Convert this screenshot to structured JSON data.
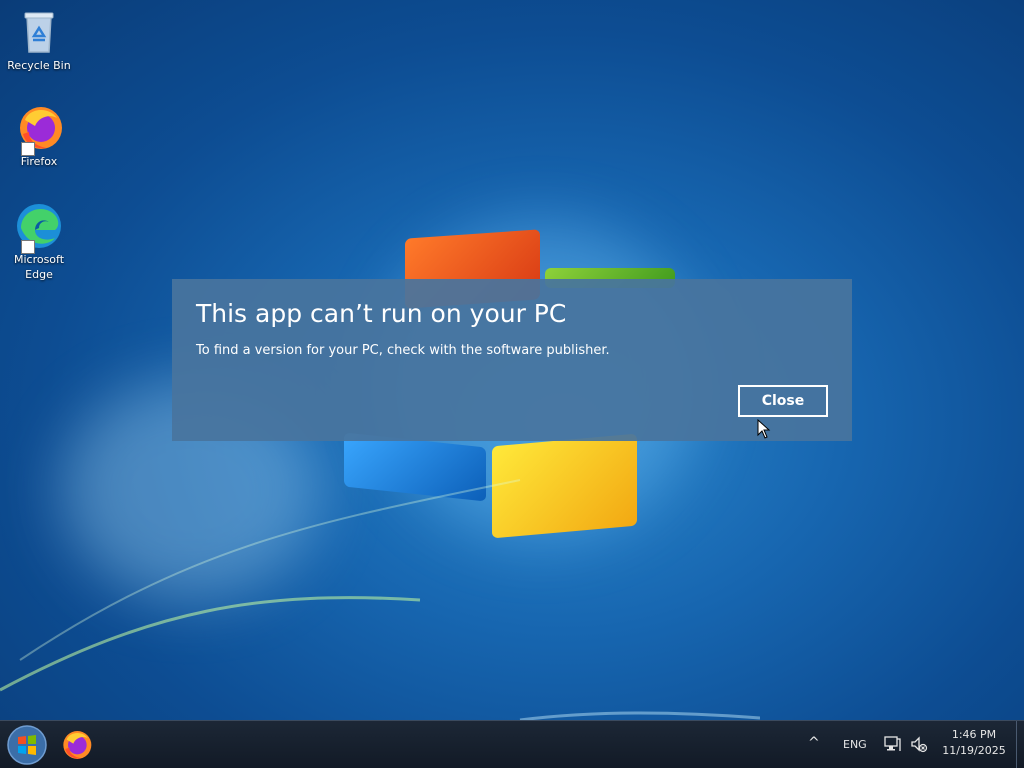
{
  "desktop": {
    "icons": [
      {
        "label": "Recycle Bin",
        "icon": "recycle-bin-icon"
      },
      {
        "label": "Firefox",
        "icon": "firefox-icon"
      },
      {
        "label": "Microsoft Edge",
        "icon": "edge-icon"
      }
    ]
  },
  "dialog": {
    "title": "This app can’t run on your PC",
    "message": "To find a version for your PC, check with the software publisher.",
    "close_label": "Close"
  },
  "taskbar": {
    "start_icon": "windows-logo-icon",
    "pinned": [
      {
        "icon": "firefox-icon"
      }
    ],
    "tray": {
      "chevron": "^",
      "language": "ENG",
      "network_icon": "network-icon",
      "volume_icon": "volume-muted-icon",
      "time": "1:46 PM",
      "date": "11/19/2025"
    }
  },
  "colors": {
    "dialog_bg": "#48749E",
    "taskbar_bg": "#17202E",
    "desktop_bg": "#1766B0"
  }
}
